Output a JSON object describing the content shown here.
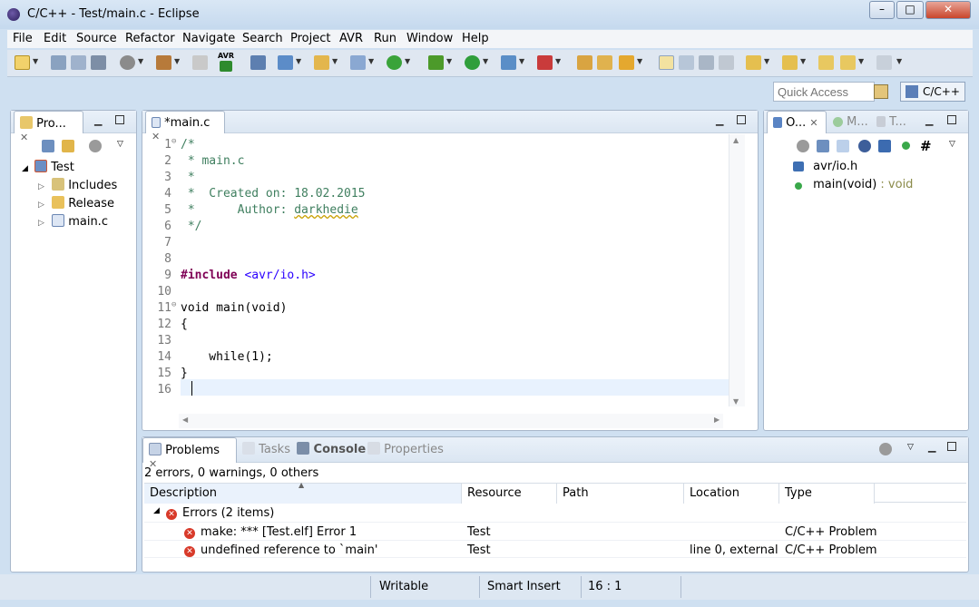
{
  "window": {
    "title": "C/C++ - Test/main.c - Eclipse",
    "controls": {
      "minimize": "–",
      "maximize": "□",
      "close": "✕"
    }
  },
  "menu": [
    "File",
    "Edit",
    "Source",
    "Refactor",
    "Navigate",
    "Search",
    "Project",
    "AVR",
    "Run",
    "Window",
    "Help"
  ],
  "toolbar": {
    "quick_access_placeholder": "Quick Access",
    "perspective_label": "C/C++",
    "avr_label": "AVR"
  },
  "project_explorer": {
    "tab_label": "Pro...",
    "tree": [
      {
        "label": "Test",
        "icon": "c-project-error-icon"
      },
      {
        "label": "Includes",
        "icon": "includes-folder-icon"
      },
      {
        "label": "Release",
        "icon": "folder-icon"
      },
      {
        "label": "main.c",
        "icon": "c-source-file-icon"
      }
    ]
  },
  "editor": {
    "tab_label": "*main.c",
    "lines": [
      {
        "n": "1",
        "text": "/*"
      },
      {
        "n": "2",
        "text": " * main.c"
      },
      {
        "n": "3",
        "text": " *"
      },
      {
        "n": "4",
        "text": " *  Created on: 18.02.2015"
      },
      {
        "n": "5",
        "text": " *      Author: "
      },
      {
        "n": "6",
        "text": " */"
      },
      {
        "n": "7",
        "text": ""
      },
      {
        "n": "8",
        "text": ""
      },
      {
        "n": "9",
        "text": "#include "
      },
      {
        "n": "10",
        "text": ""
      },
      {
        "n": "11",
        "text": "void main(void)"
      },
      {
        "n": "12",
        "text": "{"
      },
      {
        "n": "13",
        "text": ""
      },
      {
        "n": "14",
        "text": "    while(1);"
      },
      {
        "n": "15",
        "text": "}"
      },
      {
        "n": "16",
        "text": ""
      }
    ],
    "author": "darkhedie",
    "include_path": "<avr/io.h>"
  },
  "outline": {
    "tabs": [
      "O...",
      "M...",
      "T..."
    ],
    "items": [
      {
        "label": "avr/io.h",
        "type": ""
      },
      {
        "label": "main(void)",
        "type": " : void"
      }
    ]
  },
  "problems": {
    "tabs": [
      "Problems",
      "Tasks",
      "Console",
      "Properties"
    ],
    "summary": "2 errors, 0 warnings, 0 others",
    "columns": [
      "Description",
      "Resource",
      "Path",
      "Location",
      "Type"
    ],
    "group_label": "Errors (2 items)",
    "rows": [
      {
        "description": "make: *** [Test.elf] Error 1",
        "resource": "Test",
        "path": "",
        "location": "",
        "type": "C/C++ Problem"
      },
      {
        "description": "undefined reference to `main'",
        "resource": "Test",
        "path": "",
        "location": "line 0, external ...",
        "type": "C/C++ Problem"
      }
    ]
  },
  "status_bar": {
    "writable": "Writable",
    "insert_mode": "Smart Insert",
    "position": "16 : 1"
  }
}
